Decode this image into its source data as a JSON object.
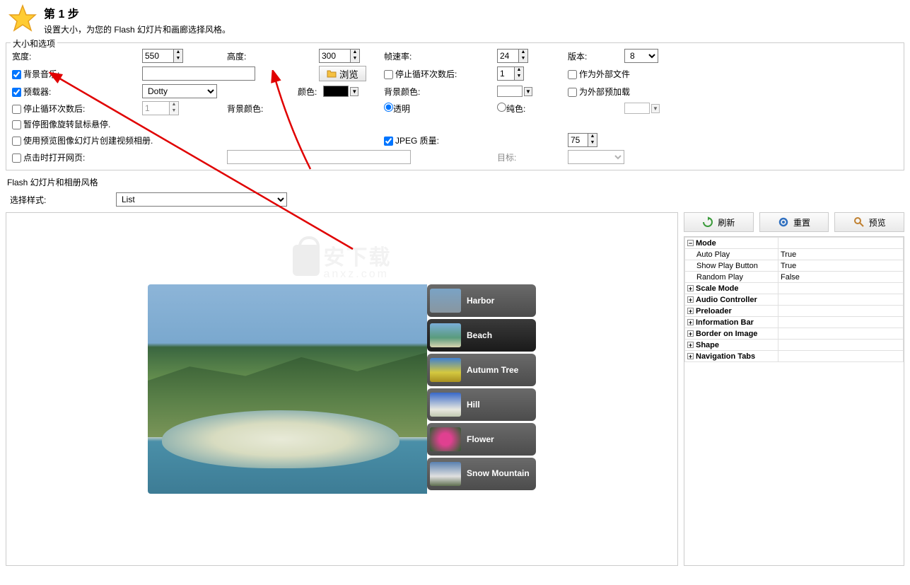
{
  "header": {
    "step_title": "第 1 步",
    "desc": "设置大小，为您的 Flash 幻灯片和画廊选择风格。"
  },
  "fieldset_title": "大小和选项",
  "options": {
    "width_label": "宽度:",
    "width_value": "550",
    "height_label": "高度:",
    "height_value": "300",
    "framerate_label": "帧速率:",
    "framerate_value": "24",
    "version_label": "版本:",
    "version_value": "8",
    "bgmusic_label": "背景音乐:",
    "bgmusic_value": "",
    "browse_label": "浏览",
    "stoploop_after_label": "停止循环次数后:",
    "stoploop_after_value": "1",
    "external_file_label": "作为外部文件",
    "preloader_label": "预载器:",
    "preloader_value": "Dotty",
    "color_label": "颜色:",
    "preloader_color": "#000000",
    "bgcolor_label": "背景颜色:",
    "bgcolor_value": "#ffffff",
    "external_preload_label": "为外部预加载",
    "stoploop_label": "停止循环次数后:",
    "stoploop_value": "1",
    "bgcolor2_label": "背景颜色:",
    "transparent_label": "透明",
    "solid_label": "纯色:",
    "solid_color": "#ffffff",
    "pauseonhover_label": "暂停图像旋转鼠标悬停.",
    "usepreview_label": "使用预览图像幻灯片创建视频相册.",
    "jpeg_label": "JPEG 质量:",
    "jpeg_value": "75",
    "openurl_label": "点击时打开网页:",
    "openurl_value": "",
    "target_label": "目标:"
  },
  "style_section_title": "Flash 幻灯片和相册风格",
  "style_label": "选择样式:",
  "style_value": "List",
  "buttons": {
    "refresh": "刷新",
    "reset": "重置",
    "preview": "预览"
  },
  "tree": {
    "mode": {
      "label": "Mode",
      "autoplay_k": "Auto Play",
      "autoplay_v": "True",
      "showbtn_k": "Show Play Button",
      "showbtn_v": "True",
      "random_k": "Random Play",
      "random_v": "False"
    },
    "scale": "Scale Mode",
    "audio": "Audio Controller",
    "preloader": "Preloader",
    "info": "Information Bar",
    "border": "Border on Image",
    "shape": "Shape",
    "navtabs": "Navigation Tabs"
  },
  "thumbs": [
    {
      "name": "Harbor",
      "bg": "linear-gradient(#7aa3c5,#8896a0)"
    },
    {
      "name": "Beach",
      "bg": "linear-gradient(#7aaed8,#5a9b7d 60%,#d8d4b0)"
    },
    {
      "name": "Autumn Tree",
      "bg": "linear-gradient(#4080d0,#d4c840 60%,#a89020)"
    },
    {
      "name": "Hill",
      "bg": "linear-gradient(#3868c8,#e8e8e0 70%,#c0c8b0)"
    },
    {
      "name": "Flower",
      "bg": "radial-gradient(circle,#e04090 30%,#2a6030)"
    },
    {
      "name": "Snow Mountain",
      "bg": "linear-gradient(#5a80b0,#e0e0e0 60%,#607050)"
    }
  ],
  "watermark": {
    "main": "安下载",
    "sub": "anxz.com"
  }
}
